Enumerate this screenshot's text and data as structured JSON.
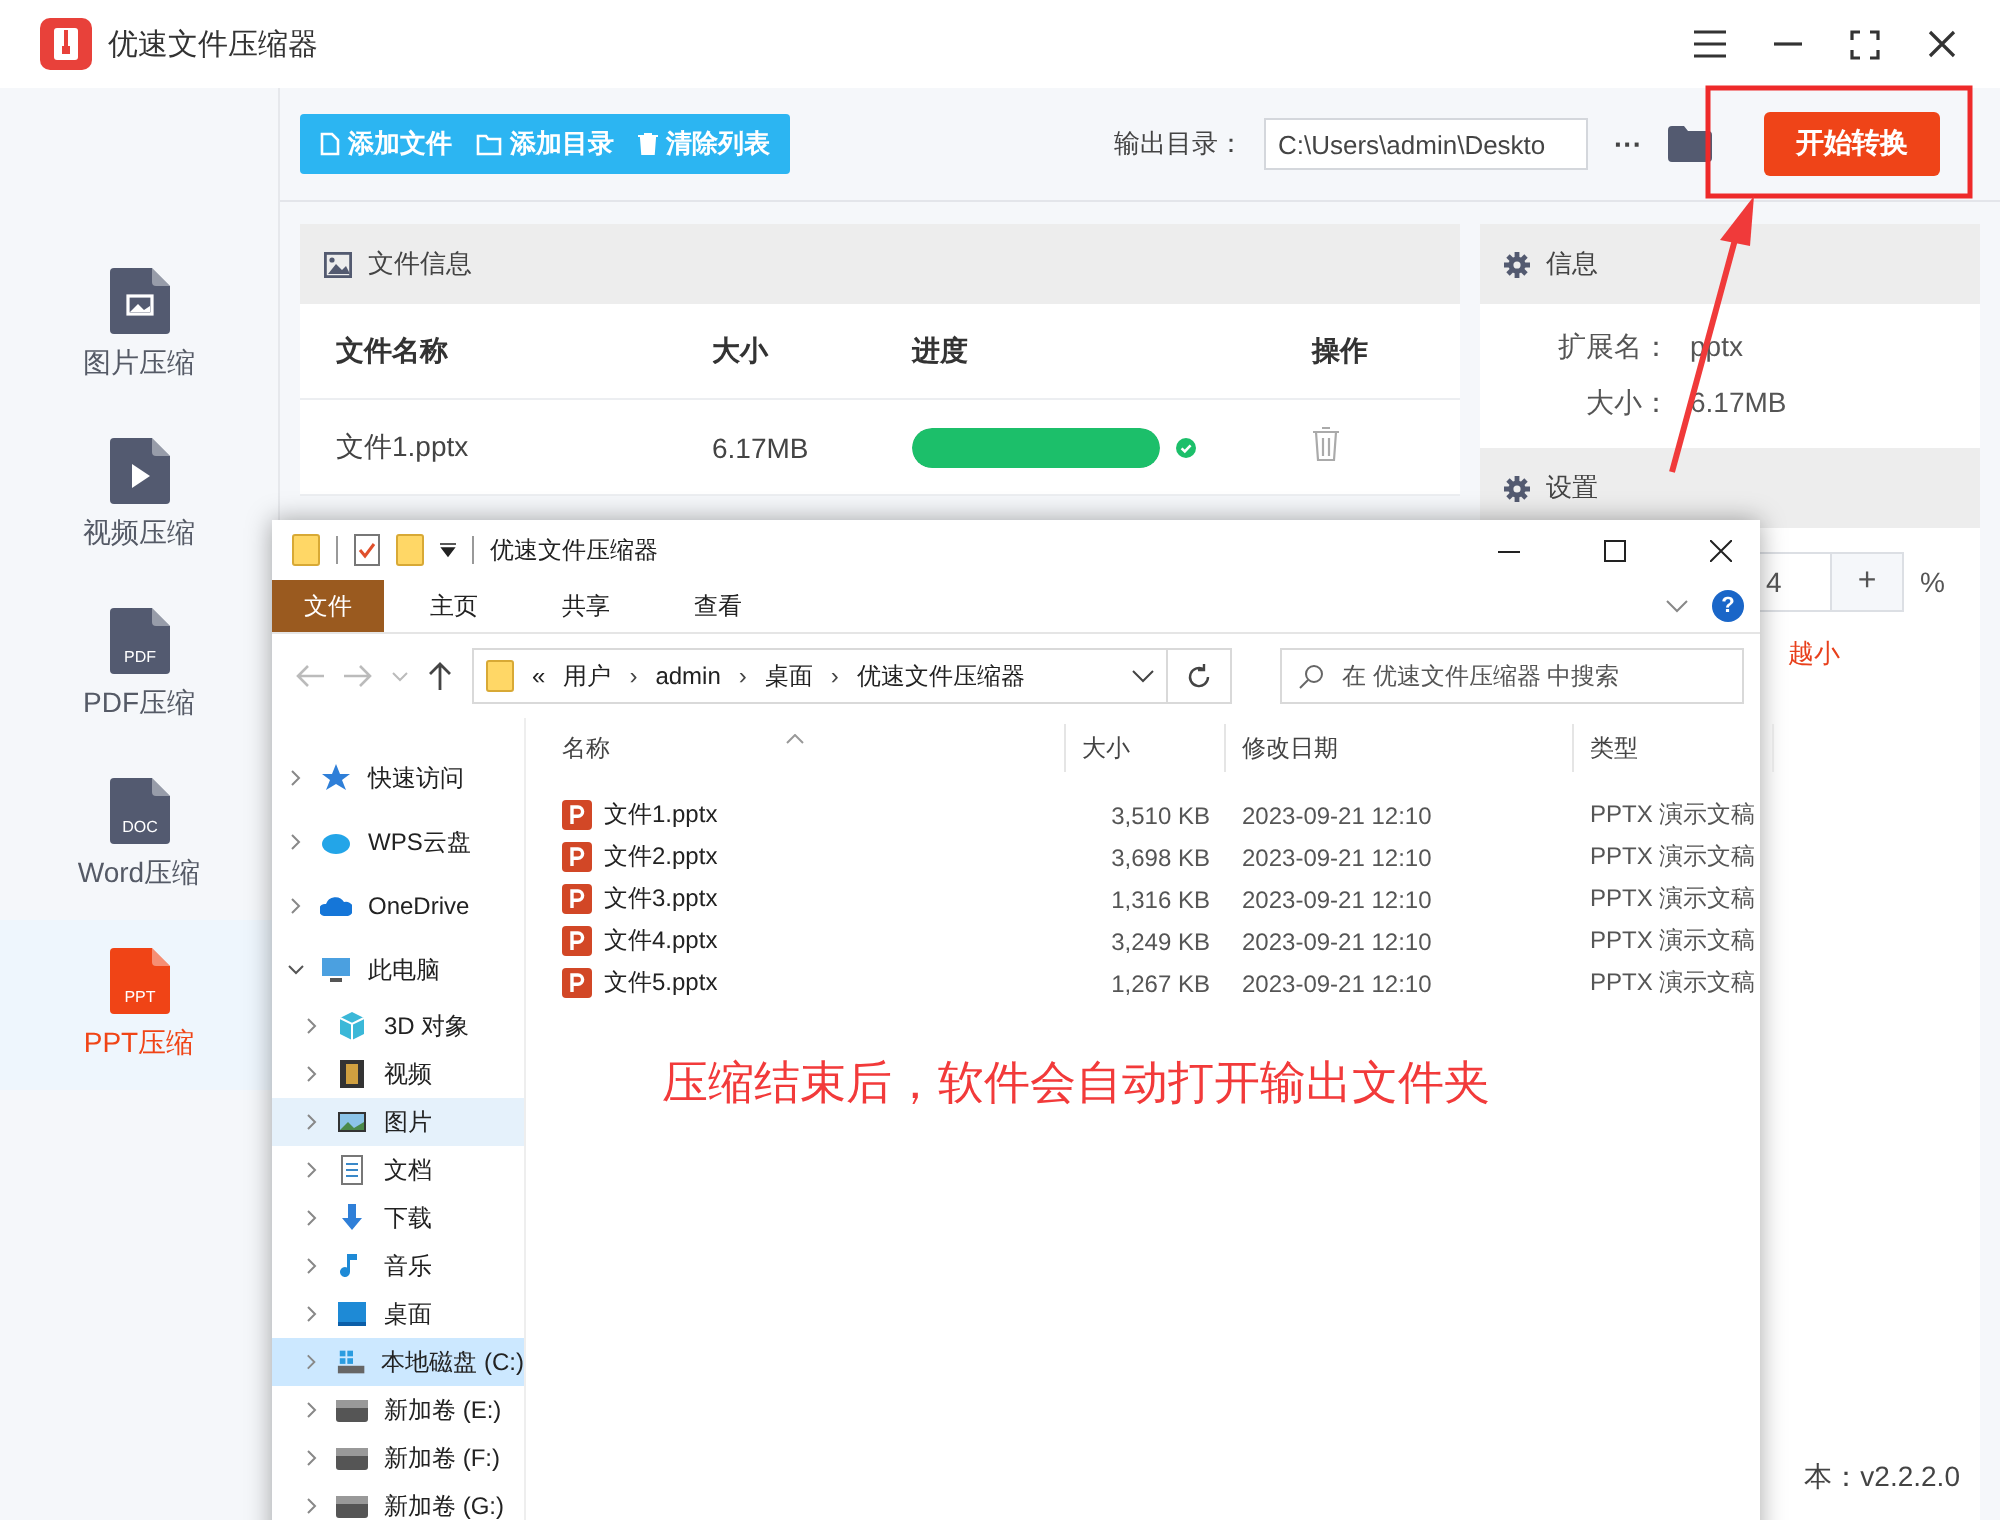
{
  "app": {
    "title": "优速文件压缩器"
  },
  "sidebar": {
    "items": [
      {
        "kind": "image",
        "label": "图片压缩",
        "selected": false
      },
      {
        "kind": "video",
        "label": "视频压缩",
        "selected": false
      },
      {
        "kind": "pdf",
        "icon_text": "PDF",
        "label": "PDF压缩",
        "selected": false
      },
      {
        "kind": "doc",
        "icon_text": "DOC",
        "label": "Word压缩",
        "selected": false
      },
      {
        "kind": "ppt",
        "icon_text": "PPT",
        "label": "PPT压缩",
        "selected": true
      }
    ]
  },
  "toolbar": {
    "buttons": [
      {
        "kind": "file",
        "label": "添加文件"
      },
      {
        "kind": "folder",
        "label": "添加目录"
      },
      {
        "kind": "trash",
        "label": "清除列表"
      }
    ],
    "output_label": "输出目录：",
    "output_path": "C:\\Users\\admin\\Deskto",
    "more": "···",
    "start": "开始转换"
  },
  "file_panel": {
    "title": "文件信息",
    "columns": [
      "文件名称",
      "大小",
      "进度",
      "操作"
    ],
    "rows": [
      {
        "name": "文件1.pptx",
        "size": "6.17MB",
        "level": 1,
        "done": true
      }
    ]
  },
  "info_panel": {
    "title": "信息",
    "fields": [
      {
        "label": "扩展名：",
        "value": "pptx"
      },
      {
        "label": "大小：",
        "value": "6.17MB"
      }
    ]
  },
  "settings_panel": {
    "title": "设置",
    "value": "4",
    "plus": "+",
    "unit": "%",
    "hint": "越小"
  },
  "version": "本：v2.2.2.0",
  "explorer": {
    "title": "优速文件压缩器",
    "ribbon": [
      {
        "label": "文件",
        "selected": true
      },
      {
        "label": "主页",
        "selected": false
      },
      {
        "label": "共享",
        "selected": false
      },
      {
        "label": "查看",
        "selected": false
      }
    ],
    "help": "?",
    "path": [
      "«",
      "用户",
      "admin",
      "桌面",
      "优速文件压缩器"
    ],
    "path_separator": "›",
    "search_placeholder": "在 优速文件压缩器 中搜索",
    "nav": [
      {
        "kind": "star",
        "label": "快速访问",
        "expanded": false,
        "selected": false,
        "hovered": false
      },
      {
        "kind": "cloud-wps",
        "label": "WPS云盘",
        "expanded": false,
        "selected": false,
        "hovered": false
      },
      {
        "kind": "cloud",
        "label": "OneDrive",
        "expanded": false,
        "selected": false,
        "hovered": false
      },
      {
        "kind": "pc",
        "label": "此电脑",
        "expanded": true,
        "selected": false,
        "hovered": false,
        "children": [
          {
            "kind": "cube",
            "label": "3D 对象",
            "expanded": false,
            "selected": false,
            "hovered": false
          },
          {
            "kind": "film",
            "label": "视频",
            "expanded": false,
            "selected": false,
            "hovered": false
          },
          {
            "kind": "picture",
            "label": "图片",
            "expanded": false,
            "selected": false,
            "hovered": true
          },
          {
            "kind": "doc",
            "label": "文档",
            "expanded": false,
            "selected": false,
            "hovered": false
          },
          {
            "kind": "download",
            "label": "下载",
            "expanded": false,
            "selected": false,
            "hovered": false
          },
          {
            "kind": "music",
            "label": "音乐",
            "expanded": false,
            "selected": false,
            "hovered": false
          },
          {
            "kind": "desktop",
            "label": "桌面",
            "expanded": false,
            "selected": false,
            "hovered": false
          },
          {
            "kind": "osdrive",
            "label": "本地磁盘 (C:)",
            "expanded": false,
            "selected": true,
            "hovered": false
          },
          {
            "kind": "drive",
            "label": "新加卷 (E:)",
            "expanded": false,
            "selected": false,
            "hovered": false
          },
          {
            "kind": "drive",
            "label": "新加卷 (F:)",
            "expanded": false,
            "selected": false,
            "hovered": false
          },
          {
            "kind": "drive",
            "label": "新加卷 (G:)",
            "expanded": false,
            "selected": false,
            "hovered": false
          }
        ]
      }
    ],
    "columns": [
      "名称",
      "大小",
      "修改日期",
      "类型"
    ],
    "files": [
      {
        "name": "文件1.pptx",
        "size": "3,510 KB",
        "date": "2023-09-21 12:10",
        "type": "PPTX 演示文稿"
      },
      {
        "name": "文件2.pptx",
        "size": "3,698 KB",
        "date": "2023-09-21 12:10",
        "type": "PPTX 演示文稿"
      },
      {
        "name": "文件3.pptx",
        "size": "1,316 KB",
        "date": "2023-09-21 12:10",
        "type": "PPTX 演示文稿"
      },
      {
        "name": "文件4.pptx",
        "size": "3,249 KB",
        "date": "2023-09-21 12:10",
        "type": "PPTX 演示文稿"
      },
      {
        "name": "文件5.pptx",
        "size": "1,267 KB",
        "date": "2023-09-21 12:10",
        "type": "PPTX 演示文稿"
      }
    ]
  },
  "annotation": {
    "caption": "压缩结束后，软件会自动打开输出文件夹"
  }
}
